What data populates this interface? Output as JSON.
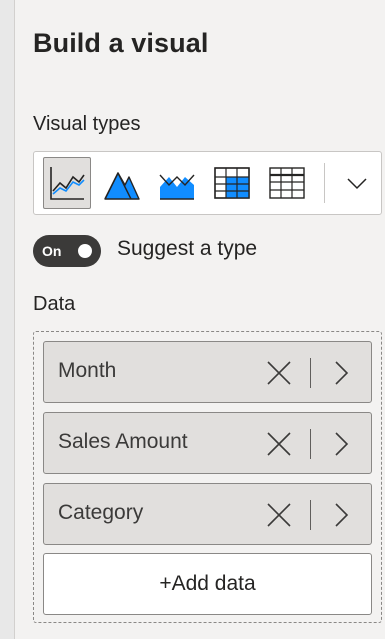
{
  "pane": {
    "title": "Build a visual",
    "visual_types_label": "Visual types",
    "visual_types": [
      {
        "name": "line-chart-icon",
        "selected": true
      },
      {
        "name": "area-chart-icon",
        "selected": false
      },
      {
        "name": "line-area-chart-icon",
        "selected": false
      },
      {
        "name": "matrix-icon",
        "selected": false
      },
      {
        "name": "table-icon",
        "selected": false
      }
    ],
    "expand_icon": "chevron-down-icon",
    "suggest_toggle": {
      "state_label": "On",
      "label": "Suggest a type"
    },
    "data_label": "Data",
    "fields": [
      {
        "label": "Month"
      },
      {
        "label": "Sales Amount"
      },
      {
        "label": "Category"
      }
    ],
    "add_data_label": "+Add data"
  },
  "colors": {
    "accent_blue": "#118dff",
    "pane_bg": "#f3f2f1",
    "toggle_bg": "#3b3a39"
  }
}
